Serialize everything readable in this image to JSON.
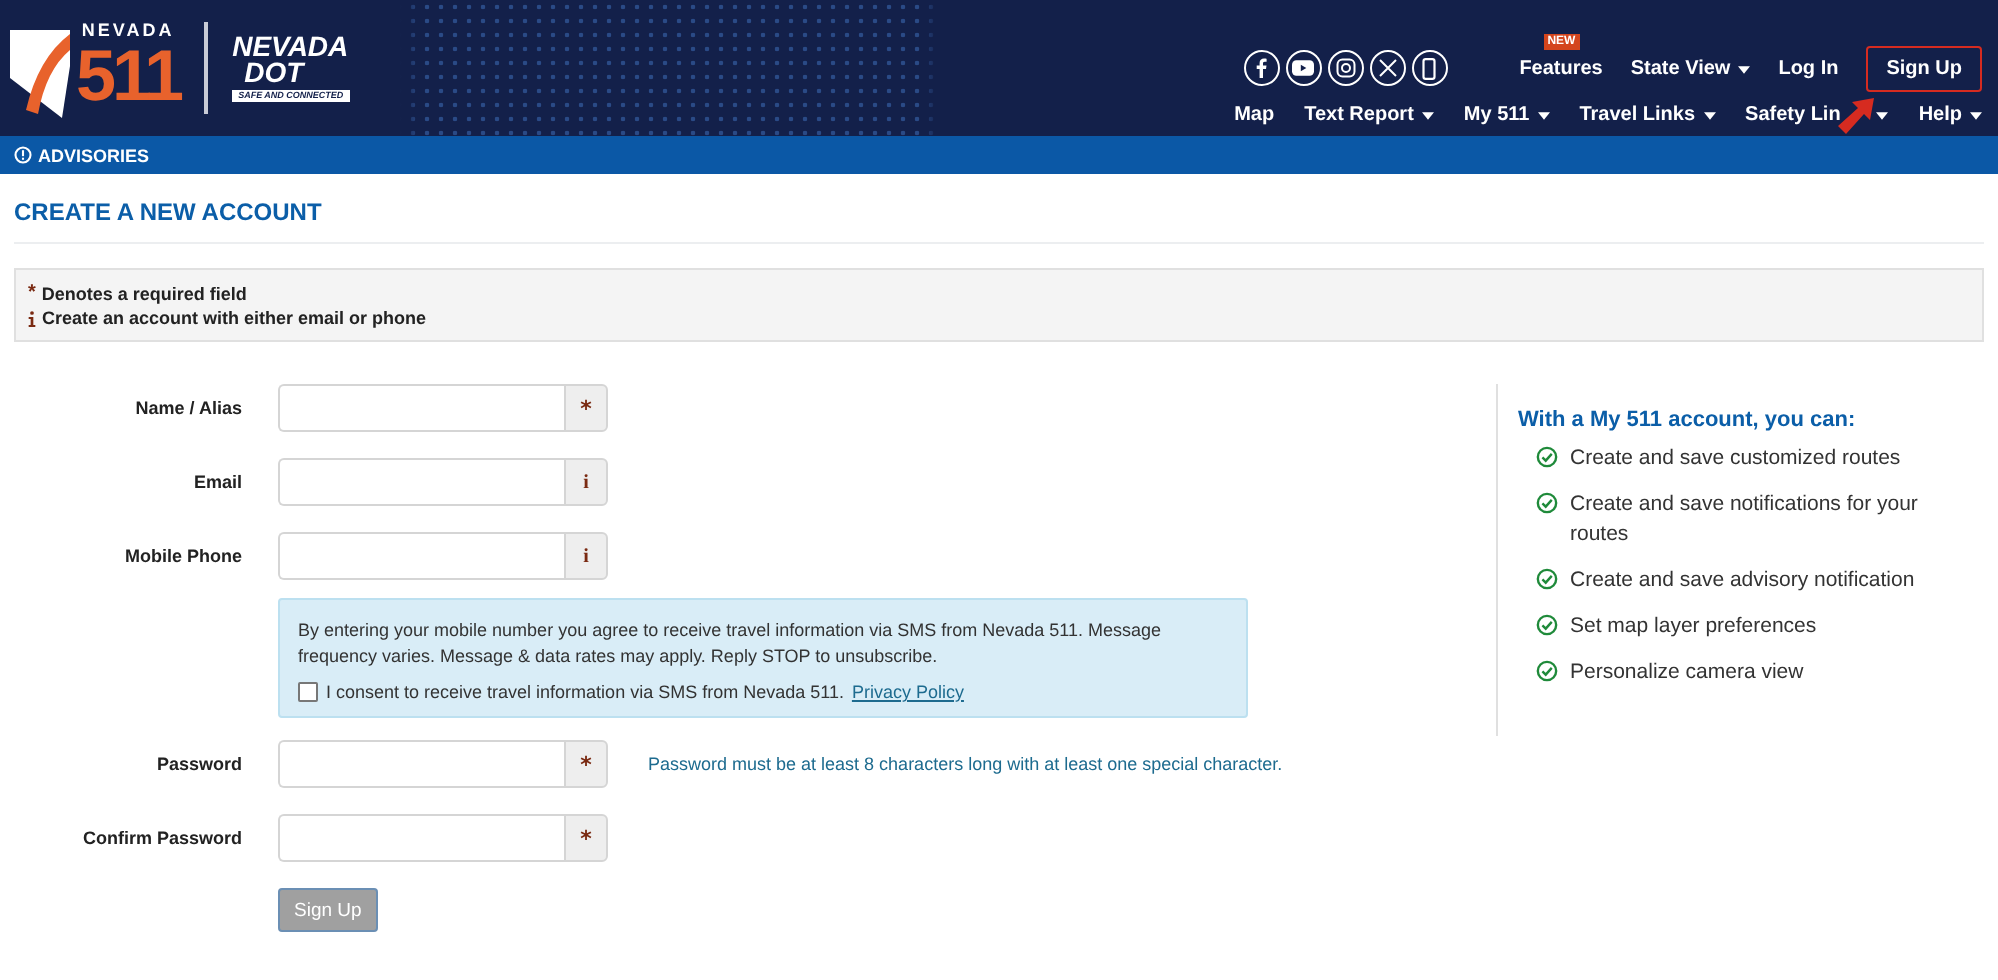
{
  "header": {
    "logo_511": {
      "top": "NEVADA",
      "number": "511"
    },
    "logo_dot": {
      "name": "NEVADA",
      "sub": "DOT",
      "tagline": "SAFE AND CONNECTED"
    },
    "top_links": [
      {
        "kind": "link",
        "label": "Features",
        "badge": "NEW"
      },
      {
        "kind": "dropdown",
        "label": "State View"
      },
      {
        "kind": "link",
        "label": "Log In"
      },
      {
        "kind": "button",
        "label": "Sign Up",
        "highlighted": true
      }
    ],
    "nav": [
      {
        "label": "Map",
        "dropdown": false
      },
      {
        "label": "Text Report",
        "dropdown": true
      },
      {
        "label": "My 511",
        "dropdown": true
      },
      {
        "label": "Travel Links",
        "dropdown": true
      },
      {
        "label": "Safety Lin",
        "dropdown": true,
        "pointer_arrow": true
      },
      {
        "label": "Help",
        "dropdown": true
      }
    ]
  },
  "advisories": {
    "label": "ADVISORIES"
  },
  "page_title": "CREATE A NEW ACCOUNT",
  "notes": [
    {
      "kind": "required",
      "marker": "*",
      "text": "Denotes a required field"
    },
    {
      "kind": "info",
      "text": "Create an account with either email or phone"
    }
  ],
  "fields": [
    {
      "label": "Name / Alias",
      "addon": {
        "kind": "required",
        "text": "*"
      }
    },
    {
      "label": "Email",
      "addon": {
        "kind": "info",
        "text": "i"
      }
    },
    {
      "label": "Mobile Phone",
      "addon": {
        "kind": "info",
        "text": "i"
      },
      "notice": {
        "text": "By entering your mobile number you agree to receive travel information via SMS from Nevada 511. Message frequency varies. Message & data rates may apply. Reply STOP to unsubscribe.",
        "consent": "I consent to receive travel information via SMS from Nevada 511.",
        "checked": false,
        "link": "Privacy Policy"
      }
    },
    {
      "label": "Password",
      "addon": {
        "kind": "required",
        "text": "*"
      },
      "hint": "Password must be at least 8 characters long with at least one special character."
    },
    {
      "label": "Confirm Password",
      "addon": {
        "kind": "required",
        "text": "*"
      }
    }
  ],
  "submit": {
    "label": "Sign Up",
    "disabled": true
  },
  "benefits": {
    "title": "With a My 511 account, you can:",
    "items": [
      "Create and save customized routes",
      "Create and save notifications for your routes",
      "Create and save advisory notification",
      "Set map layer preferences",
      "Personalize camera view"
    ]
  }
}
